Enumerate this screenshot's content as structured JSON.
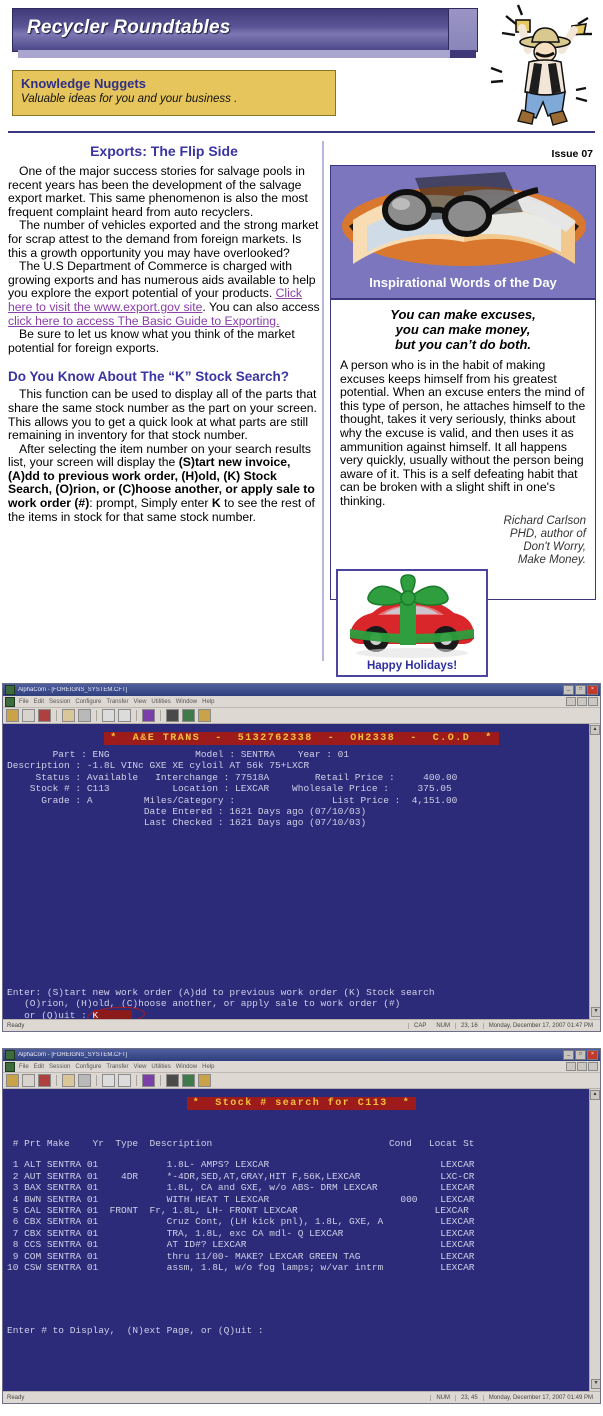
{
  "masthead": {
    "title": "Recycler Roundtables",
    "nugget_title": "Knowledge Nuggets",
    "nugget_sub": "Valuable ideas for you and your business ."
  },
  "newsletter": {
    "issue": "Issue 07",
    "article1": {
      "headline": "Exports: The Flip Side",
      "p1": "One of the major success stories for salvage pools in recent years has been the development of the salvage export market. This same phenomenon is also the most frequent complaint heard from auto recyclers.",
      "p2": "The number of vehicles exported and the strong market for scrap attest to the demand from foreign markets. Is this a growth opportunity you may have overlooked?",
      "p3_a": "The U.S Department of Commerce is charged with growing exports and has numerous aids available to help you explore the export potential of your products. ",
      "link1": "Click here to visit the www.export.gov site",
      "p3_b": ". You can also access ",
      "link2": "click here to access The Basic Guide to Exporting.",
      "p4": "Be sure to let us know what you think of the market potential for foreign exports."
    },
    "article2": {
      "headline": "Do You Know About The “K” Stock Search?",
      "p1": "This function can be used to display all of the parts that share the same stock number as the part on your screen. This allows you to get a quick look at what parts are still remaining in inventory for that stock number.",
      "p2_a": "After selecting the item number on your search results list, your screen will display the ",
      "p2_bold": "(S)tart new invoice, (A)dd to previous work order, (H)old, (K) Stock Search, (O)rion, or (C)hoose another, or apply sale to work order (#)",
      "p2_b": ": prompt, Simply enter ",
      "p2_key": "K",
      "p2_c": " to see the rest of the items in stock for that same stock number."
    },
    "inspiration": {
      "header_label": "Inspirational Words of the Day",
      "quote_line1": "You can make excuses,",
      "quote_line2": "you can make money,",
      "quote_line3": "but you can’t do both.",
      "body": "A person who is in the habit of making excuses keeps himself from his greatest potential. When an excuse enters the mind of this type of person, he attaches himself to the thought, takes it very seriously, thinks about why the excuse is valid, and then uses it as ammunition against himself. It all happens very quickly, usually without the person being aware of it. This is a self defeating habit that can be broken with a slight shift in one's thinking.",
      "attrib_line1": "Richard Carlson",
      "attrib_line2": "PHD, author of",
      "attrib_line3": "Don't Worry,",
      "attrib_line4": "Make Money.",
      "holiday_label": "Happy Holidays!"
    }
  },
  "terminal1": {
    "window_title": "AlphaCom - [FOREIGNS_SYSTEM.CFT]",
    "menu_items": [
      "File",
      "Edit",
      "Session",
      "Configure",
      "Transfer",
      "View",
      "Utilities",
      "Window",
      "Help"
    ],
    "banner": "*  A&E TRANS  -  5132762338  -  OH2338  -  C.O.D  *",
    "lines": [
      "        Part : ENG               Model : SENTRA    Year : 01",
      "",
      "Description : -1.8L VINc GXE XE cyloil AT 56k 75+LXCR",
      "     Status : Available   Interchange : 77518A        Retail Price :     400.00",
      "    Stock # : C113           Location : LEXCAR    Wholesale Price :     375.05",
      "      Grade : A         Miles/Category :                 List Price :  4,151.00",
      "                        Date Entered : 1621 Days ago (07/10/03)",
      "                        Last Checked : 1621 Days ago (07/10/03)"
    ],
    "prompt_line1": "Enter: (S)tart new work order (A)dd to previous work order (K) Stock search",
    "prompt_line2": "   (O)rion, (H)old, (C)hoose another, or apply sale to work order (#)",
    "prompt_line3": "   or (Q)uit : ",
    "prompt_input": "K",
    "status_ready": "Ready",
    "status_cap": "CAP",
    "status_num": "NUM",
    "status_pos": "23, 16",
    "status_time": "Monday, December 17, 2007  01:47 PM"
  },
  "terminal2": {
    "window_title": "AlphaCom - [FOREIGNS_SYSTEM.CFT]",
    "menu_items": [
      "File",
      "Edit",
      "Session",
      "Configure",
      "Transfer",
      "View",
      "Utilities",
      "Window",
      "Help"
    ],
    "banner": "*  Stock # search for C113  *",
    "header_line": " # Prt Make    Yr  Type  Description                               Cond   Locat St",
    "rows": [
      " 1 ALT SENTRA 01            1.8L- AMPS? LEXCAR                              LEXCAR",
      " 2 AUT SENTRA 01    4DR     *-4DR,SED,AT,GRAY,HIT F,56K,LEXCAR              LXC-CR",
      " 3 BAX SENTRA 01            1.8L, CA and GXE, w/o ABS- DRM LEXCAR           LEXCAR",
      " 4 BWN SENTRA 01            WITH HEAT T LEXCAR                       000    LEXCAR",
      " 5 CAL SENTRA 01  FRONT  Fr, 1.8L, LH- FRONT LEXCAR                        LEXCAR",
      " 6 CBX SENTRA 01            Cruz Cont, (LH kick pnl), 1.8L, GXE, A          LEXCAR",
      " 7 CBX SENTRA 01            TRA, 1.8L, exc CA mdl- Q LEXCAR                 LEXCAR",
      " 8 CCS SENTRA 01            AT ID#? LEXCAR                                  LEXCAR",
      " 9 COM SENTRA 01            thru 11/00- MAKE? LEXCAR GREEN TAG              LEXCAR",
      "10 CSW SENTRA 01            assm, 1.8L, w/o fog lamps; w/var intrm          LEXCAR"
    ],
    "prompt": "Enter # to Display,  (N)ext Page, or (Q)uit :",
    "status_ready": "Ready",
    "status_num": "NUM",
    "status_pos": "23, 45",
    "status_time": "Monday, December 17, 2007  01:49 PM"
  },
  "colors": {
    "masthead_purple": "#403a7a",
    "nugget_gold": "#e6c55c",
    "headline_blue": "#3a34a0",
    "link_purple": "#8b3fa8",
    "terminal_bg": "#2b2b7a",
    "banner_red": "#9e1b1b",
    "banner_gold": "#f0c040"
  }
}
